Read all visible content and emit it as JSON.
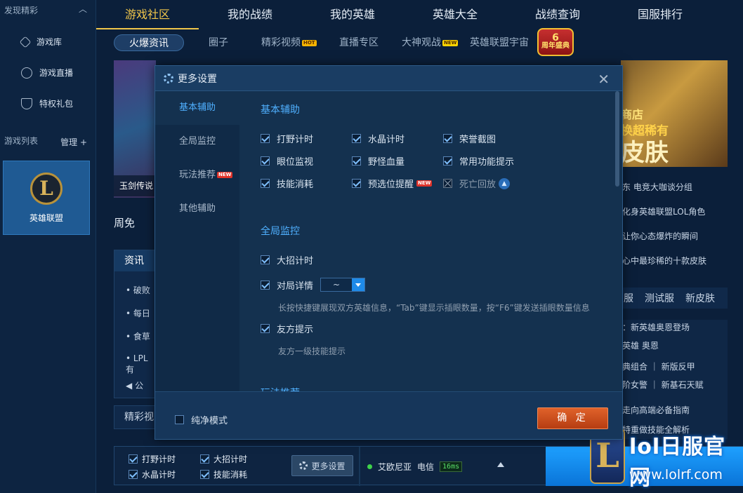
{
  "sidebar": {
    "header": "发现精彩",
    "items": [
      {
        "label": "游戏库",
        "icon": "crosshair-icon"
      },
      {
        "label": "游戏直播",
        "icon": "play-icon"
      },
      {
        "label": "特权礼包",
        "icon": "shield-icon"
      }
    ],
    "list_label": "游戏列表",
    "manage_label": "管理 +",
    "game_tile": {
      "label": "英雄联盟",
      "logo": "L"
    }
  },
  "topnav": [
    "游戏社区",
    "我的战绩",
    "我的英雄",
    "英雄大全",
    "战绩查询",
    "国服排行"
  ],
  "subnav": {
    "active": "火爆资讯",
    "items": [
      "圈子",
      "精彩视频",
      "直播专区",
      "大神观战",
      "英雄联盟宇宙"
    ],
    "hot_tag": "HOT",
    "new_tag": "NEW",
    "anniv_top": "6",
    "anniv_bottom": "周年盛典"
  },
  "banner": {
    "left_caption": "玉剑传说",
    "right_line1": "商店",
    "right_line2": "换超稀有",
    "right_line3": "皮肤"
  },
  "right_list": [
    "东 电竞大咖谈分组",
    "化身英雄联盟LOL角色",
    "让你心态爆炸的瞬间",
    "心中最珍稀的十款皮肤"
  ],
  "right_tabs": [
    "服",
    "测试服",
    "新皮肤"
  ],
  "right_news": [
    "：新英雄奥恩登场",
    "英雄 奥恩",
    "典组合 ｜ 新版反甲",
    "阶女警 ｜ 新基石天赋",
    "走向高端必备指南",
    "特重做技能全解析"
  ],
  "left_content": {
    "zhoumian": "周免",
    "tab": "资讯",
    "rows": [
      "破败",
      "每日",
      "食草",
      "LPL有",
      "公"
    ],
    "video": "精彩视"
  },
  "dialog": {
    "title": "更多设置",
    "nav": [
      "基本辅助",
      "全局监控",
      "玩法推荐",
      "其他辅助"
    ],
    "new_tag": "NEW",
    "section_basic": "基本辅助",
    "basic_options": [
      {
        "label": "打野计时",
        "checked": true
      },
      {
        "label": "水晶计时",
        "checked": true
      },
      {
        "label": "荣誉截图",
        "checked": true
      },
      {
        "label": "眼位监视",
        "checked": true
      },
      {
        "label": "野怪血量",
        "checked": true
      },
      {
        "label": "常用功能提示",
        "checked": true
      },
      {
        "label": "技能消耗",
        "checked": true
      },
      {
        "label": "预选位提醒",
        "checked": true
      },
      {
        "label": "死亡回放",
        "checked": false
      }
    ],
    "section_global": "全局监控",
    "global_options": {
      "ult": "大招计时",
      "detail": "对局详情",
      "detail_select": "~",
      "detail_hint": "长按快捷键展现双方英雄信息，“Tab”键显示插眼数量，按“F6”键发送插眼数量信息",
      "ally": "友方提示",
      "ally_hint": "友方一级技能提示"
    },
    "section_play": "玩法推荐",
    "pure_mode": "纯净模式",
    "confirm": "确 定"
  },
  "bottom": {
    "checks": [
      "打野计时",
      "大招计时",
      "水晶计时",
      "技能消耗"
    ],
    "more_settings": "更多设置",
    "server": "艾欧尼亚",
    "isp": "电信",
    "ping": "16ms"
  },
  "watermark": {
    "title": "lol日服官网",
    "url": "www.lolrf.com",
    "logo": "L"
  }
}
